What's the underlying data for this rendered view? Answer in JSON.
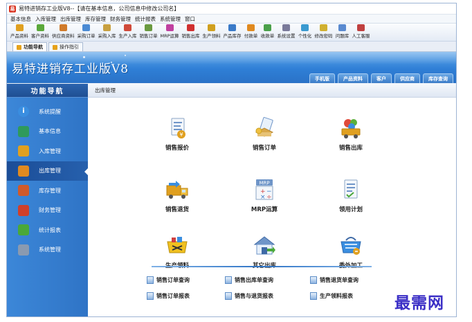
{
  "window": {
    "title": "易特进销存工业版V8--【请在基本信息，公司信息中修改公司名】"
  },
  "menu": [
    "基本信息",
    "入库管理",
    "出库管理",
    "库存管理",
    "财务管理",
    "统计报表",
    "系统管理",
    "窗口"
  ],
  "toolbar": [
    {
      "label": "产品资料",
      "color": "#e0a020"
    },
    {
      "label": "客户资料",
      "color": "#5aa83a"
    },
    {
      "label": "供应商资料",
      "color": "#d07a2a"
    },
    {
      "label": "采购订单",
      "color": "#4a8ad4"
    },
    {
      "label": "采购入库",
      "color": "#c8a040"
    },
    {
      "label": "生产入库",
      "color": "#d04a3a"
    },
    {
      "label": "销售订单",
      "color": "#6a9a40"
    },
    {
      "label": "MRP运算",
      "color": "#c040a0"
    },
    {
      "label": "销售出库",
      "color": "#d03030"
    },
    {
      "label": "生产领料",
      "color": "#d0a020"
    },
    {
      "label": "产品库存",
      "color": "#3a7ac8"
    },
    {
      "label": "付款单",
      "color": "#e08a20"
    },
    {
      "label": "收款单",
      "color": "#4aa04a"
    },
    {
      "label": "系统设置",
      "color": "#7a7a9a"
    },
    {
      "label": "个性化",
      "color": "#3a9ad0"
    },
    {
      "label": "修改密码",
      "color": "#d0b030"
    },
    {
      "label": "问题库",
      "color": "#5a8ad0"
    },
    {
      "label": "人工客服",
      "color": "#c04040"
    }
  ],
  "tabs": [
    {
      "label": "功能导航",
      "active": true
    },
    {
      "label": "操作指引",
      "active": false
    }
  ],
  "banner": {
    "brand": "易特进销存工业版V8",
    "quick_tabs": [
      "手机版",
      "产品资料",
      "客户",
      "供应商",
      "库存查询"
    ]
  },
  "sidebar": {
    "header": "功能导航",
    "items": [
      {
        "label": "系统提醒",
        "icon": "info-icon",
        "color": "#3a8ee0",
        "active": false
      },
      {
        "label": "基本信息",
        "icon": "box-stack-icon",
        "color": "#2f9a5a",
        "active": false
      },
      {
        "label": "入库管理",
        "icon": "inbound-box-icon",
        "color": "#e0a020",
        "active": false
      },
      {
        "label": "出库管理",
        "icon": "outbound-box-icon",
        "color": "#e08a20",
        "active": true
      },
      {
        "label": "库存管理",
        "icon": "warehouse-icon",
        "color": "#d05a2a",
        "active": false
      },
      {
        "label": "财务管理",
        "icon": "finance-icon",
        "color": "#d0402a",
        "active": false
      },
      {
        "label": "统计报表",
        "icon": "bar-chart-icon",
        "color": "#4aa83a",
        "active": false
      },
      {
        "label": "系统管理",
        "icon": "tools-icon",
        "color": "#8a9ab0",
        "active": false
      }
    ]
  },
  "content": {
    "header": "出库管理",
    "functions": [
      {
        "label": "销售报价",
        "icon": "sales-quote-icon"
      },
      {
        "label": "销售订单",
        "icon": "sales-order-icon"
      },
      {
        "label": "销售出库",
        "icon": "sales-outbound-icon"
      },
      {
        "label": "销售退货",
        "icon": "sales-return-icon"
      },
      {
        "label": "MRP运算",
        "icon": "mrp-calc-icon",
        "badge": "MRP"
      },
      {
        "label": "领用计划",
        "icon": "usage-plan-icon"
      },
      {
        "label": "生产领料",
        "icon": "production-picking-icon"
      },
      {
        "label": "其它出库",
        "icon": "other-outbound-icon"
      },
      {
        "label": "委外加工",
        "icon": "outsourcing-icon"
      }
    ],
    "quick_links": [
      {
        "label": "销售订单查询"
      },
      {
        "label": "销售出库单查询"
      },
      {
        "label": "销售退货单查询"
      },
      {
        "label": "销售订单报表"
      },
      {
        "label": "销售与退货报表"
      },
      {
        "label": "生产领料报表"
      }
    ]
  },
  "watermark": "最需网"
}
